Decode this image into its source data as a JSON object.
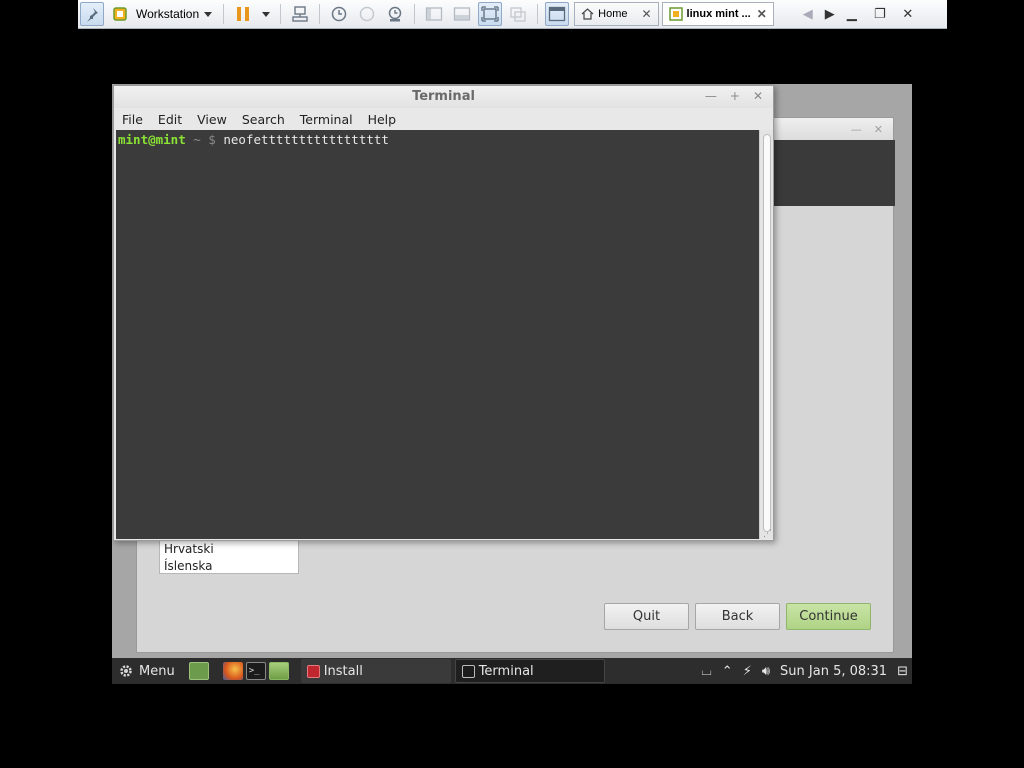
{
  "host_toolbar": {
    "product_label": "Workstation",
    "tabs": [
      {
        "label": "Home"
      },
      {
        "label": "linux mint ..."
      }
    ],
    "close_tab_glyph": "✕"
  },
  "installer": {
    "languages": [
      "Hrvatski",
      "Íslenska"
    ],
    "buttons": {
      "quit": "Quit",
      "back": "Back",
      "continue": "Continue"
    }
  },
  "terminal": {
    "title": "Terminal",
    "menu": [
      "File",
      "Edit",
      "View",
      "Search",
      "Terminal",
      "Help"
    ],
    "prompt_user": "mint@mint",
    "prompt_path": " ~ $",
    "command": " neofettttttttttttttttt"
  },
  "panel": {
    "menu_label": "Menu",
    "tasks": [
      {
        "label": "Install"
      },
      {
        "label": "Terminal"
      }
    ],
    "clock": "Sun Jan  5, 08:31"
  },
  "colors": {
    "prompt_green": "#8ae234",
    "terminal_bg": "#3b3b3b",
    "continue_green": "#afd386"
  }
}
